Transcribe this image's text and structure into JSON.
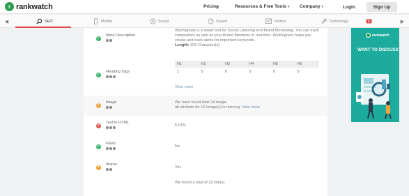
{
  "nav": {
    "logo_text": "rankwatch",
    "logo_mark": "r",
    "links": [
      "Pricing",
      "Resources & Free Tools",
      "Company"
    ],
    "login": "Login",
    "signup": "Sign Up"
  },
  "tabs": {
    "items": [
      "SEO",
      "Mobile",
      "Social",
      "Speed",
      "Visitors",
      "Technology"
    ],
    "active": "SEO"
  },
  "rows": {
    "meta": {
      "label": "Meta Description",
      "value_lines": [
        "WebSignals is a smart tool for Social Listening and Brand Monitoring. You can track",
        "competitors as well as your Brand Mentions in real-time. WebSignals helps you",
        "create and track alerts for important keywords."
      ],
      "length_label": "Length:",
      "length_value": " 209 Character(s)"
    },
    "headings": {
      "label": "Heading Tags",
      "columns": [
        "H1",
        "H2",
        "H3",
        "H4",
        "H5",
        "H6"
      ],
      "values": [
        "1",
        "5",
        "0",
        "0",
        "0",
        "0"
      ],
      "view_more": "View more"
    },
    "image": {
      "label": "Image",
      "line1": "We have found total 24 image",
      "line2": "alt attribute for 12 image(s) is missing.",
      "view_more": "View more"
    },
    "text_html": {
      "label": "Text to HTML",
      "value": "5.01%"
    },
    "flash": {
      "label": "Flash",
      "value": "No"
    },
    "iframe": {
      "label": "Iframe",
      "value": "Yes"
    },
    "links": {
      "value": "We found a total of 22 link(s)."
    }
  },
  "ad": {
    "logo_text": "rankwatch",
    "headline": "WANT TO DISCUSS"
  },
  "colors": {
    "accent": "#e24b4b",
    "ok": "#3bb36a",
    "warn": "#f0a43a",
    "error": "#e05454",
    "ad_bg": "#1cab9c"
  }
}
